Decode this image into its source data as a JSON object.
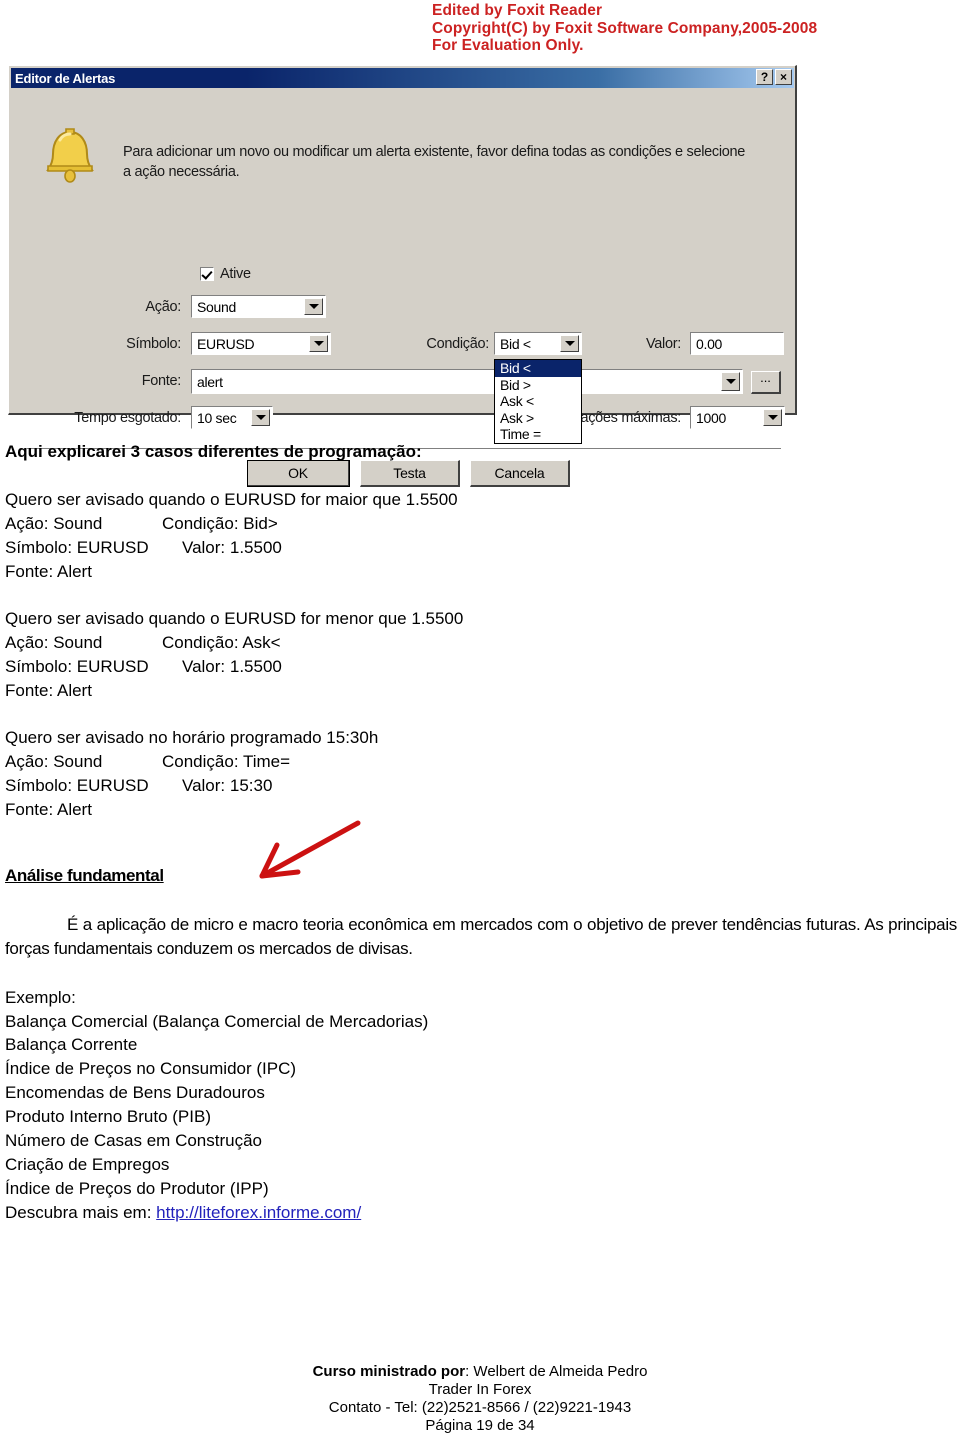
{
  "watermark": {
    "line1": "Edited by Foxit Reader",
    "line2": "Copyright(C) by Foxit Software Company,2005-2008",
    "line3": "For Evaluation Only.",
    "color": "#cc2222"
  },
  "dialog": {
    "title": "Editor de Alertas",
    "help_button": "?",
    "close_button": "×",
    "bell_icon": "bell-icon",
    "intro_line1": "Para adicionar um novo ou modificar um alerta existente, favor defina todas as condições e selecione",
    "intro_line2": "a ação necessária.",
    "active_checkbox_label": "Ative",
    "active_checked": true,
    "fields": {
      "acao_label": "Ação:",
      "acao_value": "Sound",
      "simbolo_label": "Símbolo:",
      "simbolo_value": "EURUSD",
      "condicao_label": "Condição:",
      "condicao_value": "Bid <",
      "valor_label": "Valor:",
      "valor_value": "0.00",
      "fonte_label": "Fonte:",
      "fonte_value": "alert",
      "ellipsis_label": "...",
      "tempo_label": "Tempo esgotado:",
      "tempo_value": "10 sec",
      "iteracoes_label": "ações máximas:",
      "iteracoes_value": "1000"
    },
    "condicao_options": [
      "Bid <",
      "Bid >",
      "Ask <",
      "Ask >",
      "Time ="
    ],
    "condicao_selected_index": 0,
    "buttons": {
      "ok": "OK",
      "test": "Testa",
      "cancel": "Cancela"
    }
  },
  "document": {
    "heading_cases": "Aqui explicarei 3 casos diferentes de programação",
    "heading_cases_colon": ":",
    "case1": {
      "intro": "Quero ser avisado quando o EURUSD for maior que 1.5500",
      "line_acao": "Ação: Sound",
      "line_condicao": "Condição: Bid>",
      "line_simbolo": "Símbolo: EURUSD",
      "line_valor": "Valor: 1.5500",
      "line_fonte": "Fonte: Alert"
    },
    "case2": {
      "intro": "Quero ser avisado quando o EURUSD for menor que 1.5500",
      "line_acao": "Ação: Sound",
      "line_condicao": "Condição: Ask<",
      "line_simbolo": "Símbolo: EURUSD",
      "line_valor": "Valor: 1.5500",
      "line_fonte": "Fonte: Alert"
    },
    "case3": {
      "intro": "Quero ser avisado no horário programado 15:30h",
      "line_acao": "Ação: Sound",
      "line_condicao": "Condição: Time=",
      "line_simbolo": "Símbolo: EURUSD",
      "line_valor": "Valor: 15:30",
      "line_fonte": "Fonte: Alert"
    },
    "section_heading": "Análise fundamental",
    "arrow_color": "#cc1111",
    "paragraph": "É a aplicação de micro e macro teoria econômica em mercados com o objetivo de prever tendências futuras. As principais forças fundamentais conduzem os mercados de divisas.",
    "example_label": "Exemplo:",
    "example_items": [
      "Balança Comercial (Balança Comercial de Mercadorias)",
      "Balança Corrente",
      "Índice de Preços no Consumidor (IPC)",
      "Encomendas de Bens Duradouros",
      "Produto Interno Bruto (PIB)",
      "Número de Casas em Construção",
      "Criação de Empregos",
      "Índice de Preços do Produtor (IPP)"
    ],
    "discover_prefix": "Descubra mais em: ",
    "discover_link": "http://liteforex.informe.com/"
  },
  "footer": {
    "course_label": "Curso ministrado por",
    "course_instructor": ": Welbert de Almeida Pedro",
    "line2": "Trader In Forex",
    "line3": "Contato - Tel: (22)2521-8566 / (22)9221-1943",
    "line4": "Página 19 de 34"
  }
}
